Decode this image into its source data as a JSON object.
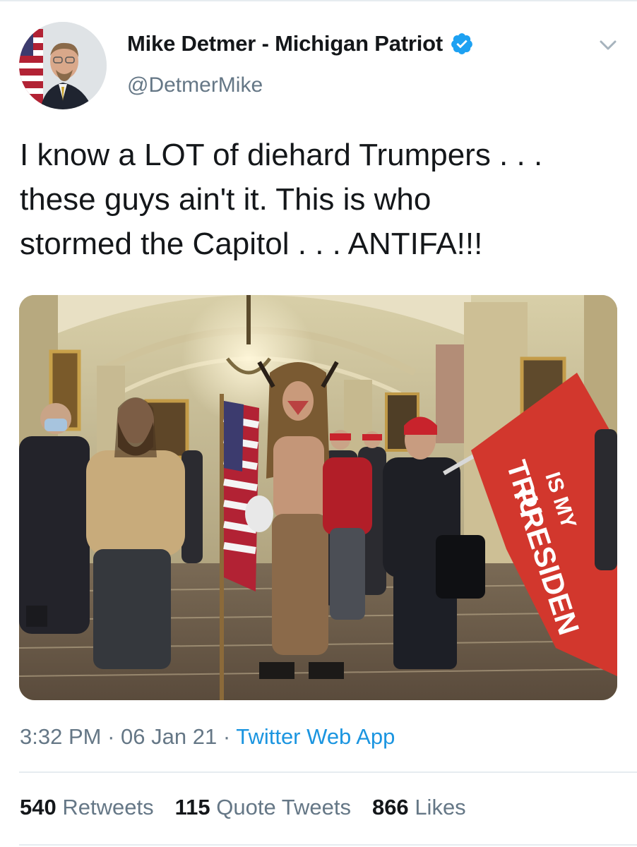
{
  "author": {
    "display_name": "Mike Detmer - Michigan Patriot",
    "handle": "@DetmerMike",
    "verified": true,
    "avatar_icon": "profile-photo"
  },
  "tweet": {
    "text": "I know a LOT of diehard Trumpers . . .\nthese guys ain't it.  This is who\nstormed the Capitol . . . ANTIFA!!!"
  },
  "media": {
    "flag_text_1": "TRU",
    "flag_text_2": "IS MY",
    "flag_text_3": "PRESIDEN"
  },
  "meta": {
    "time": "3:32 PM",
    "separator": "·",
    "date": "06 Jan 21",
    "source": "Twitter Web App"
  },
  "stats": {
    "retweets_count": "540",
    "retweets_label": "Retweets",
    "quotes_count": "115",
    "quotes_label": "Quote Tweets",
    "likes_count": "866",
    "likes_label": "Likes"
  },
  "colors": {
    "text": "#14171a",
    "secondary": "#657786",
    "link": "#1b95e0",
    "verified": "#1da1f2",
    "divider": "#e6ecf0"
  }
}
